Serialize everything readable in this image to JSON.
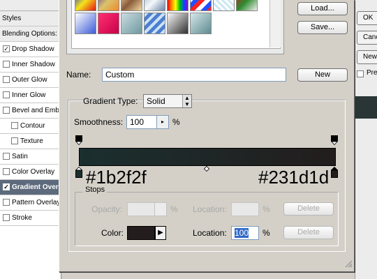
{
  "left_panel": {
    "items": [
      {
        "label": "Styles",
        "checkbox": false,
        "checked": false,
        "indent": 0,
        "header": true
      },
      {
        "label": "Blending Options: Default",
        "checkbox": false,
        "checked": false,
        "indent": 0,
        "header": true
      },
      {
        "label": "Drop Shadow",
        "checkbox": true,
        "checked": true,
        "indent": 0
      },
      {
        "label": "Inner Shadow",
        "checkbox": true,
        "checked": false,
        "indent": 0
      },
      {
        "label": "Outer Glow",
        "checkbox": true,
        "checked": false,
        "indent": 0
      },
      {
        "label": "Inner Glow",
        "checkbox": true,
        "checked": false,
        "indent": 0
      },
      {
        "label": "Bevel and Emboss",
        "checkbox": true,
        "checked": false,
        "indent": 0
      },
      {
        "label": "Contour",
        "checkbox": true,
        "checked": false,
        "indent": 1
      },
      {
        "label": "Texture",
        "checkbox": true,
        "checked": false,
        "indent": 1
      },
      {
        "label": "Satin",
        "checkbox": true,
        "checked": false,
        "indent": 0
      },
      {
        "label": "Color Overlay",
        "checkbox": true,
        "checked": false,
        "indent": 0
      },
      {
        "label": "Gradient Overlay",
        "checkbox": true,
        "checked": true,
        "indent": 0,
        "selected": true
      },
      {
        "label": "Pattern Overlay",
        "checkbox": true,
        "checked": false,
        "indent": 0
      },
      {
        "label": "Stroke",
        "checkbox": true,
        "checked": false,
        "indent": 0
      }
    ]
  },
  "right_panel": {
    "ok_label": "OK",
    "cancel_label": "Cancel",
    "new_style_label": "New Style...",
    "preview_label": "Preview"
  },
  "dialog": {
    "load_label": "Load...",
    "save_label": "Save...",
    "name_label": "Name:",
    "name_value": "Custom",
    "new_label": "New",
    "gradient_type_label": "Gradient Type:",
    "gradient_type_value": "Solid",
    "smoothness_label": "Smoothness:",
    "smoothness_value": "100",
    "smoothness_unit": "%",
    "stop_color_left": "#1b2f2f",
    "stop_color_right": "#231d1d",
    "stops": {
      "group_label": "Stops",
      "opacity_label": "Opacity:",
      "opacity_unit": "%",
      "location_label": "Location:",
      "location_unit": "%",
      "delete_label": "Delete",
      "color_label": "Color:",
      "color_swatch": "#231d1d",
      "location_value": "100"
    }
  },
  "presets": [
    "linear-gradient(135deg,#1a2fd8,#f5e31a,#e4161a)",
    "linear-gradient(135deg,#6e3b8a,#d9c36d,#f08a2a)",
    "linear-gradient(135deg,#f1d9a0,#8a5a3a,#f1d9a0)",
    "linear-gradient(135deg,#9bb2c9,#f5f8fb,#6b87a4)",
    "linear-gradient(90deg,#ff0000,#ff8c00,#ffff00,#00c000,#0050ff,#9b00d0)",
    "repeating-linear-gradient(135deg,#ff2020 0 6px,#ffffff 6px 12px,#2050ff 12px 18px)",
    "repeating-linear-gradient(45deg,#cde8f2 0 3px,#ffffff 3px 6px)",
    "linear-gradient(135deg,#c82020,#2e8a2e,#f0f0f0)",
    "linear-gradient(135deg,#ffffff,#3b5bd6)",
    "linear-gradient(135deg,#ff3070,#c8004a)",
    "linear-gradient(135deg,#c9dbe0,#6f9aa0)",
    "repeating-linear-gradient(135deg,#cde2f5 0 4px,#4b7fd0 4px 9px)",
    "linear-gradient(135deg,#f8f8f8,#303030)",
    "linear-gradient(135deg,#d6e6ea,#5c8b8f)"
  ]
}
